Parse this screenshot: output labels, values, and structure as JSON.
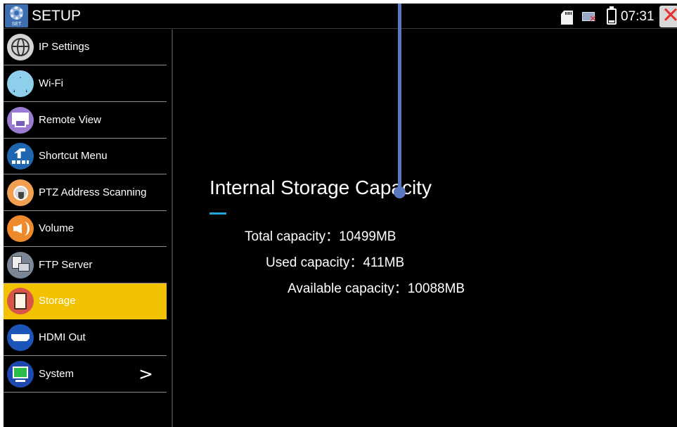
{
  "titlebar": {
    "icon_label": "SET",
    "title": "SETUP",
    "clock": "07:31"
  },
  "status_icons": [
    "sd-card-icon",
    "network-disconnected-icon",
    "battery-icon",
    "close-icon"
  ],
  "sidebar": {
    "items": [
      {
        "label": "IP Settings",
        "icon": "globe-icon",
        "active": false
      },
      {
        "label": "Wi-Fi",
        "icon": "wifi-antenna-icon",
        "active": false
      },
      {
        "label": "Remote View",
        "icon": "remote-view-icon",
        "active": false
      },
      {
        "label": "Shortcut Menu",
        "icon": "shortcut-icon",
        "active": false
      },
      {
        "label": "PTZ Address Scanning",
        "icon": "ptz-camera-icon",
        "active": false
      },
      {
        "label": "Volume",
        "icon": "speaker-icon",
        "active": false
      },
      {
        "label": "FTP Server",
        "icon": "ftp-server-icon",
        "active": false
      },
      {
        "label": "Storage",
        "icon": "sd-card-icon",
        "active": true
      },
      {
        "label": "HDMI Out",
        "icon": "hdmi-icon",
        "active": false
      },
      {
        "label": "System",
        "icon": "system-monitor-icon",
        "active": false,
        "has_submenu": true
      }
    ],
    "chevron": ">"
  },
  "content": {
    "heading": "Internal Storage Capacity",
    "total": "Total capacity：10499MB",
    "used": "Used capacity：411MB",
    "available": "Available capacity：10088MB"
  },
  "colors": {
    "active_item": "#f2c200",
    "accent_line": "#27a4d8",
    "pointer": "#5a78bf",
    "close": "#e53030"
  }
}
